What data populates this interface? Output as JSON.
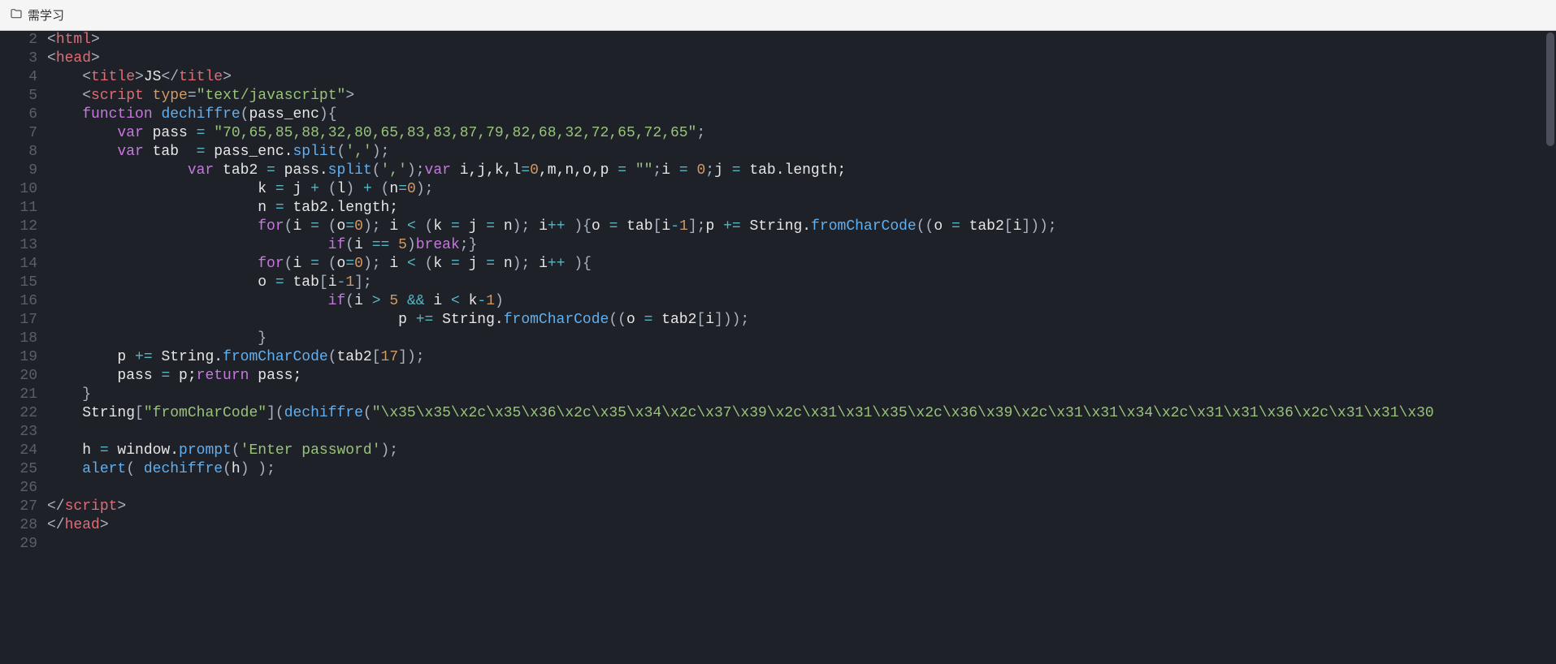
{
  "tab": {
    "label": "需学习"
  },
  "gutter": {
    "start": 2,
    "end": 29
  },
  "code_lines": [
    {
      "tokens": [
        {
          "c": "pn",
          "t": "<"
        },
        {
          "c": "tag",
          "t": "html"
        },
        {
          "c": "pn",
          "t": ">"
        }
      ]
    },
    {
      "tokens": [
        {
          "c": "pn",
          "t": "<"
        },
        {
          "c": "tag",
          "t": "head"
        },
        {
          "c": "pn",
          "t": ">"
        }
      ]
    },
    {
      "tokens": [
        {
          "c": "id",
          "t": "    "
        },
        {
          "c": "pn",
          "t": "<"
        },
        {
          "c": "tag",
          "t": "title"
        },
        {
          "c": "pn",
          "t": ">"
        },
        {
          "c": "id",
          "t": "JS"
        },
        {
          "c": "pn",
          "t": "</"
        },
        {
          "c": "tag",
          "t": "title"
        },
        {
          "c": "pn",
          "t": ">"
        }
      ]
    },
    {
      "tokens": [
        {
          "c": "id",
          "t": "    "
        },
        {
          "c": "pn",
          "t": "<"
        },
        {
          "c": "tag",
          "t": "script"
        },
        {
          "c": "id",
          "t": " "
        },
        {
          "c": "attr",
          "t": "type"
        },
        {
          "c": "pn",
          "t": "="
        },
        {
          "c": "str",
          "t": "\"text/javascript\""
        },
        {
          "c": "pn",
          "t": ">"
        }
      ]
    },
    {
      "tokens": [
        {
          "c": "id",
          "t": "    "
        },
        {
          "c": "kw",
          "t": "function"
        },
        {
          "c": "id",
          "t": " "
        },
        {
          "c": "fn",
          "t": "dechiffre"
        },
        {
          "c": "pn",
          "t": "("
        },
        {
          "c": "id",
          "t": "pass_enc"
        },
        {
          "c": "pn",
          "t": ")"
        },
        {
          "c": "pn",
          "t": "{"
        }
      ]
    },
    {
      "tokens": [
        {
          "c": "id",
          "t": "        "
        },
        {
          "c": "kw",
          "t": "var"
        },
        {
          "c": "id",
          "t": " pass "
        },
        {
          "c": "op",
          "t": "="
        },
        {
          "c": "id",
          "t": " "
        },
        {
          "c": "str",
          "t": "\"70,65,85,88,32,80,65,83,83,87,79,82,68,32,72,65,72,65\""
        },
        {
          "c": "pn",
          "t": ";"
        }
      ]
    },
    {
      "tokens": [
        {
          "c": "id",
          "t": "        "
        },
        {
          "c": "kw",
          "t": "var"
        },
        {
          "c": "id",
          "t": " tab  "
        },
        {
          "c": "op",
          "t": "="
        },
        {
          "c": "id",
          "t": " pass_enc."
        },
        {
          "c": "fn",
          "t": "split"
        },
        {
          "c": "pn",
          "t": "("
        },
        {
          "c": "str",
          "t": "','"
        },
        {
          "c": "pn",
          "t": ");"
        }
      ]
    },
    {
      "tokens": [
        {
          "c": "id",
          "t": "                "
        },
        {
          "c": "kw",
          "t": "var"
        },
        {
          "c": "id",
          "t": " tab2 "
        },
        {
          "c": "op",
          "t": "="
        },
        {
          "c": "id",
          "t": " pass."
        },
        {
          "c": "fn",
          "t": "split"
        },
        {
          "c": "pn",
          "t": "("
        },
        {
          "c": "str",
          "t": "','"
        },
        {
          "c": "pn",
          "t": ");"
        },
        {
          "c": "kw",
          "t": "var"
        },
        {
          "c": "id",
          "t": " i,j,k,l"
        },
        {
          "c": "op",
          "t": "="
        },
        {
          "c": "num",
          "t": "0"
        },
        {
          "c": "id",
          "t": ",m,n,o,p "
        },
        {
          "c": "op",
          "t": "="
        },
        {
          "c": "id",
          "t": " "
        },
        {
          "c": "str",
          "t": "\"\""
        },
        {
          "c": "pn",
          "t": ";"
        },
        {
          "c": "id",
          "t": "i "
        },
        {
          "c": "op",
          "t": "="
        },
        {
          "c": "id",
          "t": " "
        },
        {
          "c": "num",
          "t": "0"
        },
        {
          "c": "pn",
          "t": ";"
        },
        {
          "c": "id",
          "t": "j "
        },
        {
          "c": "op",
          "t": "="
        },
        {
          "c": "id",
          "t": " tab.length;"
        }
      ]
    },
    {
      "tokens": [
        {
          "c": "id",
          "t": "                        k "
        },
        {
          "c": "op",
          "t": "="
        },
        {
          "c": "id",
          "t": " j "
        },
        {
          "c": "op",
          "t": "+"
        },
        {
          "c": "id",
          "t": " "
        },
        {
          "c": "pn",
          "t": "("
        },
        {
          "c": "id",
          "t": "l"
        },
        {
          "c": "pn",
          "t": ")"
        },
        {
          "c": "id",
          "t": " "
        },
        {
          "c": "op",
          "t": "+"
        },
        {
          "c": "id",
          "t": " "
        },
        {
          "c": "pn",
          "t": "("
        },
        {
          "c": "id",
          "t": "n"
        },
        {
          "c": "op",
          "t": "="
        },
        {
          "c": "num",
          "t": "0"
        },
        {
          "c": "pn",
          "t": ");"
        }
      ]
    },
    {
      "tokens": [
        {
          "c": "id",
          "t": "                        n "
        },
        {
          "c": "op",
          "t": "="
        },
        {
          "c": "id",
          "t": " tab2.length;"
        }
      ]
    },
    {
      "tokens": [
        {
          "c": "id",
          "t": "                        "
        },
        {
          "c": "kw",
          "t": "for"
        },
        {
          "c": "pn",
          "t": "("
        },
        {
          "c": "id",
          "t": "i "
        },
        {
          "c": "op",
          "t": "="
        },
        {
          "c": "id",
          "t": " "
        },
        {
          "c": "pn",
          "t": "("
        },
        {
          "c": "id",
          "t": "o"
        },
        {
          "c": "op",
          "t": "="
        },
        {
          "c": "num",
          "t": "0"
        },
        {
          "c": "pn",
          "t": ")"
        },
        {
          "c": "pn",
          "t": ";"
        },
        {
          "c": "id",
          "t": " i "
        },
        {
          "c": "op",
          "t": "<"
        },
        {
          "c": "id",
          "t": " "
        },
        {
          "c": "pn",
          "t": "("
        },
        {
          "c": "id",
          "t": "k "
        },
        {
          "c": "op",
          "t": "="
        },
        {
          "c": "id",
          "t": " j "
        },
        {
          "c": "op",
          "t": "="
        },
        {
          "c": "id",
          "t": " n"
        },
        {
          "c": "pn",
          "t": ")"
        },
        {
          "c": "pn",
          "t": ";"
        },
        {
          "c": "id",
          "t": " i"
        },
        {
          "c": "op",
          "t": "++"
        },
        {
          "c": "id",
          "t": " "
        },
        {
          "c": "pn",
          "t": ")"
        },
        {
          "c": "pn",
          "t": "{"
        },
        {
          "c": "id",
          "t": "o "
        },
        {
          "c": "op",
          "t": "="
        },
        {
          "c": "id",
          "t": " tab"
        },
        {
          "c": "pn",
          "t": "["
        },
        {
          "c": "id",
          "t": "i"
        },
        {
          "c": "op",
          "t": "-"
        },
        {
          "c": "num",
          "t": "1"
        },
        {
          "c": "pn",
          "t": "]"
        },
        {
          "c": "pn",
          "t": ";"
        },
        {
          "c": "id",
          "t": "p "
        },
        {
          "c": "op",
          "t": "+="
        },
        {
          "c": "id",
          "t": " String."
        },
        {
          "c": "fn",
          "t": "fromCharCode"
        },
        {
          "c": "pn",
          "t": "(("
        },
        {
          "c": "id",
          "t": "o "
        },
        {
          "c": "op",
          "t": "="
        },
        {
          "c": "id",
          "t": " tab2"
        },
        {
          "c": "pn",
          "t": "["
        },
        {
          "c": "id",
          "t": "i"
        },
        {
          "c": "pn",
          "t": "]));"
        }
      ]
    },
    {
      "tokens": [
        {
          "c": "id",
          "t": "                                "
        },
        {
          "c": "kw",
          "t": "if"
        },
        {
          "c": "pn",
          "t": "("
        },
        {
          "c": "id",
          "t": "i "
        },
        {
          "c": "op",
          "t": "=="
        },
        {
          "c": "id",
          "t": " "
        },
        {
          "c": "num",
          "t": "5"
        },
        {
          "c": "pn",
          "t": ")"
        },
        {
          "c": "kw",
          "t": "break"
        },
        {
          "c": "pn",
          "t": ";}"
        }
      ]
    },
    {
      "tokens": [
        {
          "c": "id",
          "t": "                        "
        },
        {
          "c": "kw",
          "t": "for"
        },
        {
          "c": "pn",
          "t": "("
        },
        {
          "c": "id",
          "t": "i "
        },
        {
          "c": "op",
          "t": "="
        },
        {
          "c": "id",
          "t": " "
        },
        {
          "c": "pn",
          "t": "("
        },
        {
          "c": "id",
          "t": "o"
        },
        {
          "c": "op",
          "t": "="
        },
        {
          "c": "num",
          "t": "0"
        },
        {
          "c": "pn",
          "t": ")"
        },
        {
          "c": "pn",
          "t": ";"
        },
        {
          "c": "id",
          "t": " i "
        },
        {
          "c": "op",
          "t": "<"
        },
        {
          "c": "id",
          "t": " "
        },
        {
          "c": "pn",
          "t": "("
        },
        {
          "c": "id",
          "t": "k "
        },
        {
          "c": "op",
          "t": "="
        },
        {
          "c": "id",
          "t": " j "
        },
        {
          "c": "op",
          "t": "="
        },
        {
          "c": "id",
          "t": " n"
        },
        {
          "c": "pn",
          "t": ")"
        },
        {
          "c": "pn",
          "t": ";"
        },
        {
          "c": "id",
          "t": " i"
        },
        {
          "c": "op",
          "t": "++"
        },
        {
          "c": "id",
          "t": " "
        },
        {
          "c": "pn",
          "t": "){"
        }
      ]
    },
    {
      "tokens": [
        {
          "c": "id",
          "t": "                        o "
        },
        {
          "c": "op",
          "t": "="
        },
        {
          "c": "id",
          "t": " tab"
        },
        {
          "c": "pn",
          "t": "["
        },
        {
          "c": "id",
          "t": "i"
        },
        {
          "c": "op",
          "t": "-"
        },
        {
          "c": "num",
          "t": "1"
        },
        {
          "c": "pn",
          "t": "];"
        }
      ]
    },
    {
      "tokens": [
        {
          "c": "id",
          "t": "                                "
        },
        {
          "c": "kw",
          "t": "if"
        },
        {
          "c": "pn",
          "t": "("
        },
        {
          "c": "id",
          "t": "i "
        },
        {
          "c": "op",
          "t": ">"
        },
        {
          "c": "id",
          "t": " "
        },
        {
          "c": "num",
          "t": "5"
        },
        {
          "c": "id",
          "t": " "
        },
        {
          "c": "op",
          "t": "&&"
        },
        {
          "c": "id",
          "t": " i "
        },
        {
          "c": "op",
          "t": "<"
        },
        {
          "c": "id",
          "t": " k"
        },
        {
          "c": "op",
          "t": "-"
        },
        {
          "c": "num",
          "t": "1"
        },
        {
          "c": "pn",
          "t": ")"
        }
      ]
    },
    {
      "tokens": [
        {
          "c": "id",
          "t": "                                        p "
        },
        {
          "c": "op",
          "t": "+="
        },
        {
          "c": "id",
          "t": " String."
        },
        {
          "c": "fn",
          "t": "fromCharCode"
        },
        {
          "c": "pn",
          "t": "(("
        },
        {
          "c": "id",
          "t": "o "
        },
        {
          "c": "op",
          "t": "="
        },
        {
          "c": "id",
          "t": " tab2"
        },
        {
          "c": "pn",
          "t": "["
        },
        {
          "c": "id",
          "t": "i"
        },
        {
          "c": "pn",
          "t": "]));"
        }
      ]
    },
    {
      "tokens": [
        {
          "c": "id",
          "t": "                        "
        },
        {
          "c": "pn",
          "t": "}"
        }
      ]
    },
    {
      "tokens": [
        {
          "c": "id",
          "t": "        p "
        },
        {
          "c": "op",
          "t": "+="
        },
        {
          "c": "id",
          "t": " String."
        },
        {
          "c": "fn",
          "t": "fromCharCode"
        },
        {
          "c": "pn",
          "t": "("
        },
        {
          "c": "id",
          "t": "tab2"
        },
        {
          "c": "pn",
          "t": "["
        },
        {
          "c": "num",
          "t": "17"
        },
        {
          "c": "pn",
          "t": "]);"
        }
      ]
    },
    {
      "tokens": [
        {
          "c": "id",
          "t": "        pass "
        },
        {
          "c": "op",
          "t": "="
        },
        {
          "c": "id",
          "t": " p;"
        },
        {
          "c": "kw",
          "t": "return"
        },
        {
          "c": "id",
          "t": " pass;"
        }
      ]
    },
    {
      "tokens": [
        {
          "c": "id",
          "t": "    "
        },
        {
          "c": "pn",
          "t": "}"
        }
      ]
    },
    {
      "tokens": [
        {
          "c": "id",
          "t": "    String"
        },
        {
          "c": "pn",
          "t": "["
        },
        {
          "c": "str",
          "t": "\"fromCharCode\""
        },
        {
          "c": "pn",
          "t": "]("
        },
        {
          "c": "fn",
          "t": "dechiffre"
        },
        {
          "c": "pn",
          "t": "("
        },
        {
          "c": "str",
          "t": "\"\\x35\\x35\\x2c\\x35\\x36\\x2c\\x35\\x34\\x2c\\x37\\x39\\x2c\\x31\\x31\\x35\\x2c\\x36\\x39\\x2c\\x31\\x31\\x34\\x2c\\x31\\x31\\x36\\x2c\\x31\\x31\\x30"
        }
      ]
    },
    {
      "tokens": [
        {
          "c": "id",
          "t": ""
        }
      ]
    },
    {
      "tokens": [
        {
          "c": "id",
          "t": "    h "
        },
        {
          "c": "op",
          "t": "="
        },
        {
          "c": "id",
          "t": " window."
        },
        {
          "c": "fn",
          "t": "prompt"
        },
        {
          "c": "pn",
          "t": "("
        },
        {
          "c": "str",
          "t": "'Enter password'"
        },
        {
          "c": "pn",
          "t": ");"
        }
      ]
    },
    {
      "tokens": [
        {
          "c": "id",
          "t": "    "
        },
        {
          "c": "fn",
          "t": "alert"
        },
        {
          "c": "pn",
          "t": "( "
        },
        {
          "c": "fn",
          "t": "dechiffre"
        },
        {
          "c": "pn",
          "t": "("
        },
        {
          "c": "id",
          "t": "h"
        },
        {
          "c": "pn",
          "t": ") );"
        }
      ]
    },
    {
      "tokens": [
        {
          "c": "id",
          "t": ""
        }
      ]
    },
    {
      "tokens": [
        {
          "c": "pn",
          "t": "</"
        },
        {
          "c": "tag",
          "t": "script"
        },
        {
          "c": "pn",
          "t": ">"
        }
      ]
    },
    {
      "tokens": [
        {
          "c": "pn",
          "t": "</"
        },
        {
          "c": "tag",
          "t": "head"
        },
        {
          "c": "pn",
          "t": ">"
        }
      ]
    },
    {
      "tokens": [
        {
          "c": "id",
          "t": ""
        }
      ]
    }
  ]
}
